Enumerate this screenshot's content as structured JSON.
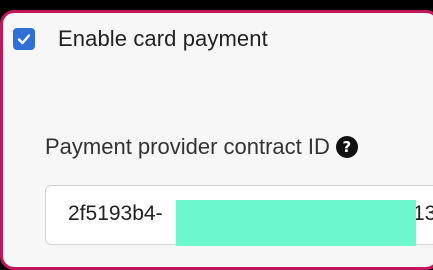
{
  "checkbox": {
    "label": "Enable card payment",
    "checked": true,
    "color": "#2f6fd6"
  },
  "contract_field": {
    "label": "Payment provider contract ID",
    "help_icon": "question-circle-icon",
    "value_start": "2f5193b4-",
    "value_end": "13",
    "redaction_color": "#6cf7cd"
  },
  "colors": {
    "frame_border": "#c2185b",
    "background": "#f7f7f8"
  }
}
